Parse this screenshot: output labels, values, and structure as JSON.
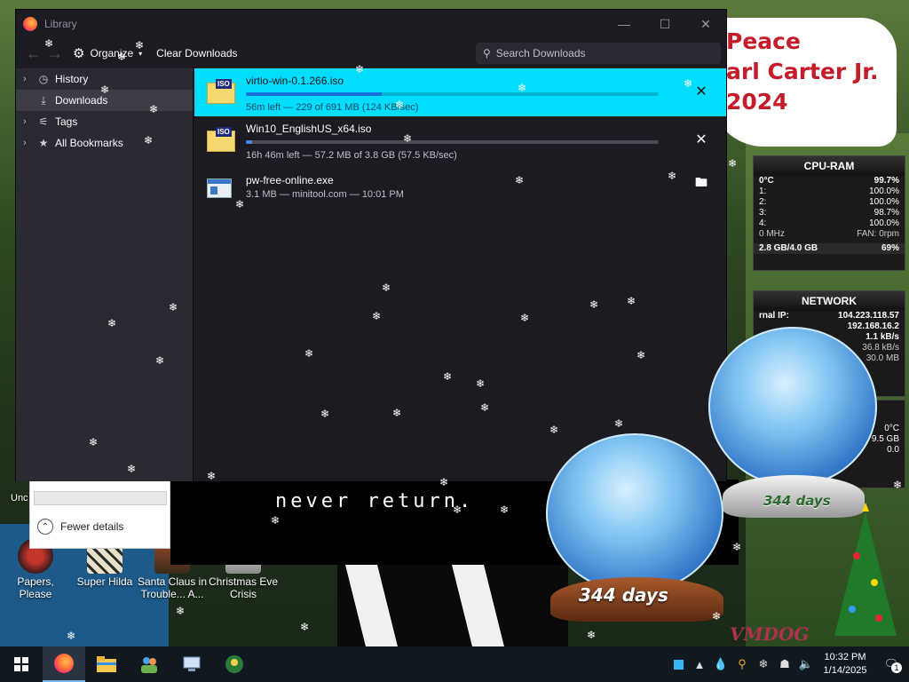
{
  "library": {
    "title": "Library",
    "toolbar": {
      "organize": "Organize",
      "clear": "Clear Downloads",
      "search_placeholder": "Search Downloads"
    },
    "sidebar": [
      {
        "label": "History",
        "icon": "clock-icon",
        "expandable": true
      },
      {
        "label": "Downloads",
        "icon": "download-icon",
        "expandable": false,
        "selected": true
      },
      {
        "label": "Tags",
        "icon": "tag-icon",
        "expandable": true
      },
      {
        "label": "All Bookmarks",
        "icon": "star-icon",
        "expandable": true
      }
    ],
    "downloads": [
      {
        "name": "virtio-win-0.1.266.iso",
        "status": "56m left — 229 of 691 MB (124 KB/sec)",
        "progress": 0.33,
        "type": "iso",
        "action": "cancel",
        "selected": true
      },
      {
        "name": "Win10_EnglishUS_x64.iso",
        "status": "16h 46m left — 57.2 MB of 3.8 GB (57.5 KB/sec)",
        "progress": 0.015,
        "type": "iso",
        "action": "cancel",
        "selected": false
      },
      {
        "name": "pw-free-online.exe",
        "status": "3.1 MB — minitool.com — 10:01 PM",
        "type": "exe",
        "action": "open-folder",
        "selected": false
      }
    ]
  },
  "background_window": {
    "text": "never return.",
    "details_toggle": "Fewer details"
  },
  "banner": {
    "line1": "Peace",
    "line2": "arl Carter Jr.",
    "line3": "2024"
  },
  "cpu_gadget": {
    "title": "CPU-RAM",
    "temp": "0°C",
    "total": "99.7%",
    "cores": [
      {
        "id": "1:",
        "val": "100.0%"
      },
      {
        "id": "2:",
        "val": "100.0%"
      },
      {
        "id": "3:",
        "val": "98.7%"
      },
      {
        "id": "4:",
        "val": "100.0%"
      }
    ],
    "freq": "0 MHz",
    "fan": "FAN: 0rpm",
    "ram": "2.8 GB/4.0 GB",
    "ram_pct": "69%"
  },
  "network_gadget": {
    "title": "NETWORK",
    "ext_label": "rnal IP:",
    "ext_ip": "104.223.118.57",
    "int_ip": "192.168.16.2",
    "up": "1.1 kB/s",
    "down": "36.8 kB/s",
    "total": "30.0 MB"
  },
  "disk_gadget": {
    "temp": "0°C",
    "size": "9.5 GB",
    "val": "0.0"
  },
  "globes": [
    {
      "days": "344 days"
    },
    {
      "days": "344 days"
    }
  ],
  "desktop_icons": [
    {
      "label": "Papers, Please"
    },
    {
      "label": "Super Hilda"
    },
    {
      "label": "Santa Claus in Trouble... A..."
    },
    {
      "label": "Christmas Eve Crisis"
    }
  ],
  "left_edge_labels": {
    "unc": "Unc"
  },
  "watermark": "VMDOG",
  "taskbar": {
    "apps": [
      "windows-start-icon",
      "firefox-icon",
      "file-explorer-icon",
      "people-icon",
      "network-computer-icon",
      "game-icon"
    ],
    "clock": {
      "time": "10:32 PM",
      "date": "1/14/2025"
    },
    "notification_count": "1"
  },
  "colors": {
    "selected_row": "#00ddff",
    "progress": "#3c8cf0",
    "banner_text": "#c41c2a"
  }
}
